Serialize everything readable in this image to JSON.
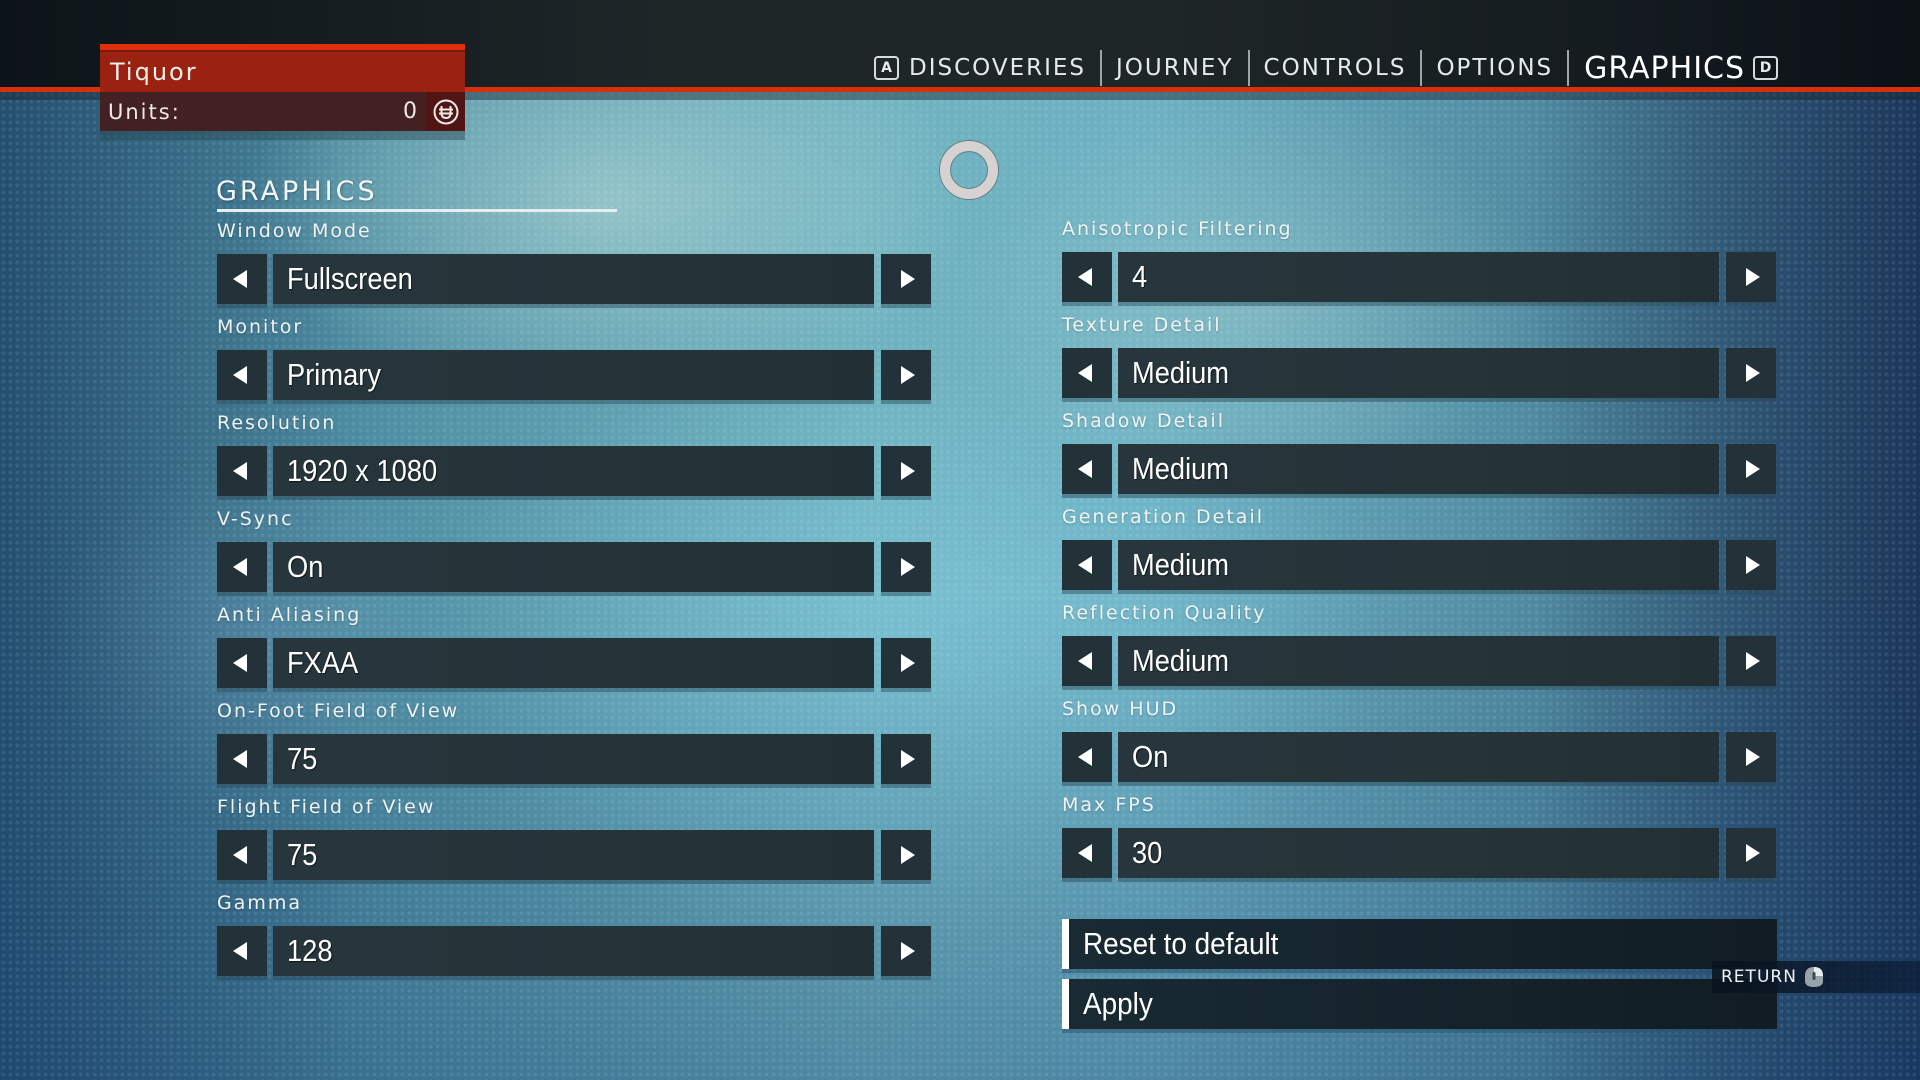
{
  "player": {
    "name": "Tiquor",
    "units_label": "Units:",
    "units_value": "0",
    "units_icon": "units-currency-icon"
  },
  "nav": {
    "prev_key": "A",
    "next_key": "D",
    "tabs": [
      {
        "label": "DISCOVERIES",
        "active": false
      },
      {
        "label": "JOURNEY",
        "active": false
      },
      {
        "label": "CONTROLS",
        "active": false
      },
      {
        "label": "OPTIONS",
        "active": false
      },
      {
        "label": "GRAPHICS",
        "active": true
      }
    ]
  },
  "section": {
    "title": "GRAPHICS"
  },
  "settings_left": [
    {
      "label": "Window Mode",
      "value": "Fullscreen"
    },
    {
      "label": "Monitor",
      "value": "Primary"
    },
    {
      "label": "Resolution",
      "value": "1920 x 1080"
    },
    {
      "label": "V-Sync",
      "value": "On"
    },
    {
      "label": "Anti Aliasing",
      "value": "FXAA"
    },
    {
      "label": "On-Foot Field of View",
      "value": "75"
    },
    {
      "label": "Flight Field of View",
      "value": "75"
    },
    {
      "label": "Gamma",
      "value": "128"
    }
  ],
  "settings_right": [
    {
      "label": "Anisotropic Filtering",
      "value": "4"
    },
    {
      "label": "Texture Detail",
      "value": "Medium"
    },
    {
      "label": "Shadow Detail",
      "value": "Medium"
    },
    {
      "label": "Generation Detail",
      "value": "Medium"
    },
    {
      "label": "Reflection Quality",
      "value": "Medium"
    },
    {
      "label": "Show HUD",
      "value": "On"
    },
    {
      "label": "Max FPS",
      "value": "30"
    }
  ],
  "actions": {
    "reset_label": "Reset to default",
    "apply_label": "Apply"
  },
  "hint": {
    "return_label": "RETURN",
    "return_icon": "mouse-right-click-icon"
  },
  "colors": {
    "accent_red": "#d6300e",
    "panel_red": "#9b2211",
    "units_bar": "#432021",
    "control_bg": "#233238"
  }
}
